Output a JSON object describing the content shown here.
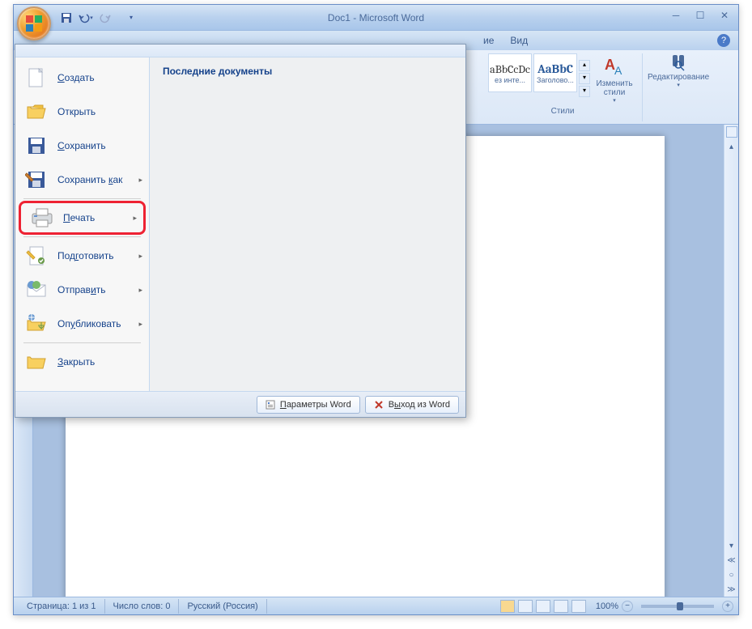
{
  "title": "Doc1 - Microsoft Word",
  "menubar": {
    "item1": "ие",
    "item2": "Вид"
  },
  "ribbon": {
    "style1_preview": "aBbCcDc",
    "style1_label": "ез инте...",
    "style2_preview": "AaBbC",
    "style2_label": "Заголово...",
    "styles_group": "Стили",
    "change_styles": "Изменить стили",
    "editing": "Редактирование"
  },
  "office_menu": {
    "create": "Создать",
    "open": "Открыть",
    "save": "Сохранить",
    "save_as": "Сохранить как",
    "print": "Печать",
    "prepare": "Подготовить",
    "send": "Отправить",
    "publish": "Опубликовать",
    "close": "Закрыть",
    "recent_title": "Последние документы",
    "word_options": "Параметры Word",
    "exit_word": "Выход из Word"
  },
  "status": {
    "page": "Страница: 1 из 1",
    "words": "Число слов: 0",
    "lang": "Русский (Россия)",
    "zoom": "100%"
  }
}
